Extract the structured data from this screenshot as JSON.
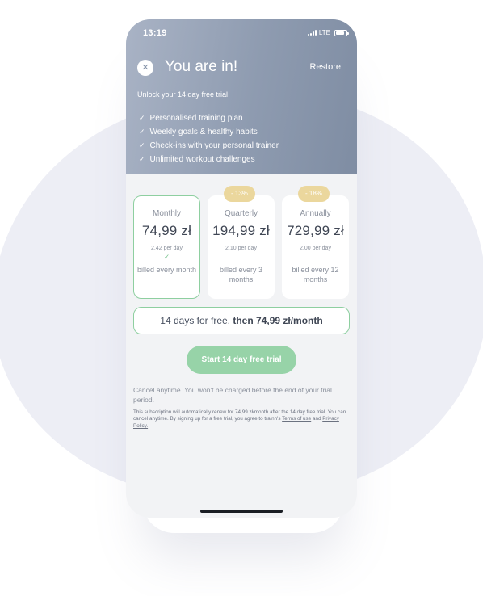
{
  "status_bar": {
    "time": "13:19",
    "network": "LTE"
  },
  "header": {
    "title": "You are in!",
    "restore_label": "Restore",
    "subtitle": "Unlock your 14 day free trial",
    "features": [
      "Personalised training plan",
      "Weekly goals & healthy habits",
      "Check-ins with your personal trainer",
      "Unlimited workout challenges"
    ]
  },
  "plans": [
    {
      "name": "Monthly",
      "price": "74,99 zł",
      "per_day": "2.42 per day",
      "billed": "billed every month",
      "selected": true,
      "badge": ""
    },
    {
      "name": "Quarterly",
      "price": "194,99 zł",
      "per_day": "2.10 per day",
      "billed": "billed every 3 months",
      "selected": false,
      "badge": "- 13%"
    },
    {
      "name": "Annually",
      "price": "729,99 zł",
      "per_day": "2.00 per day",
      "billed": "billed every 12 months",
      "selected": false,
      "badge": "- 18%"
    }
  ],
  "summary": {
    "prefix": "14 days for free, ",
    "emphasis": "then 74,99 zł/month"
  },
  "cta_label": "Start 14 day free trial",
  "cancel_note": "Cancel anytime. You won't be charged before the end of your trial period.",
  "fine_print": {
    "text": "This subscription will automatically renew for 74,99 zł/month after the 14 day free trial. You can cancel anytime. By signing up for a free trial, you agree to trainn's ",
    "terms_link": "Terms of use",
    "and": " and ",
    "privacy_link": "Privacy Policy."
  },
  "colors": {
    "header": "#8e9bb0",
    "accent_green": "#97d3a8",
    "badge": "#ebd79d",
    "background_blob": "#edeef5"
  }
}
